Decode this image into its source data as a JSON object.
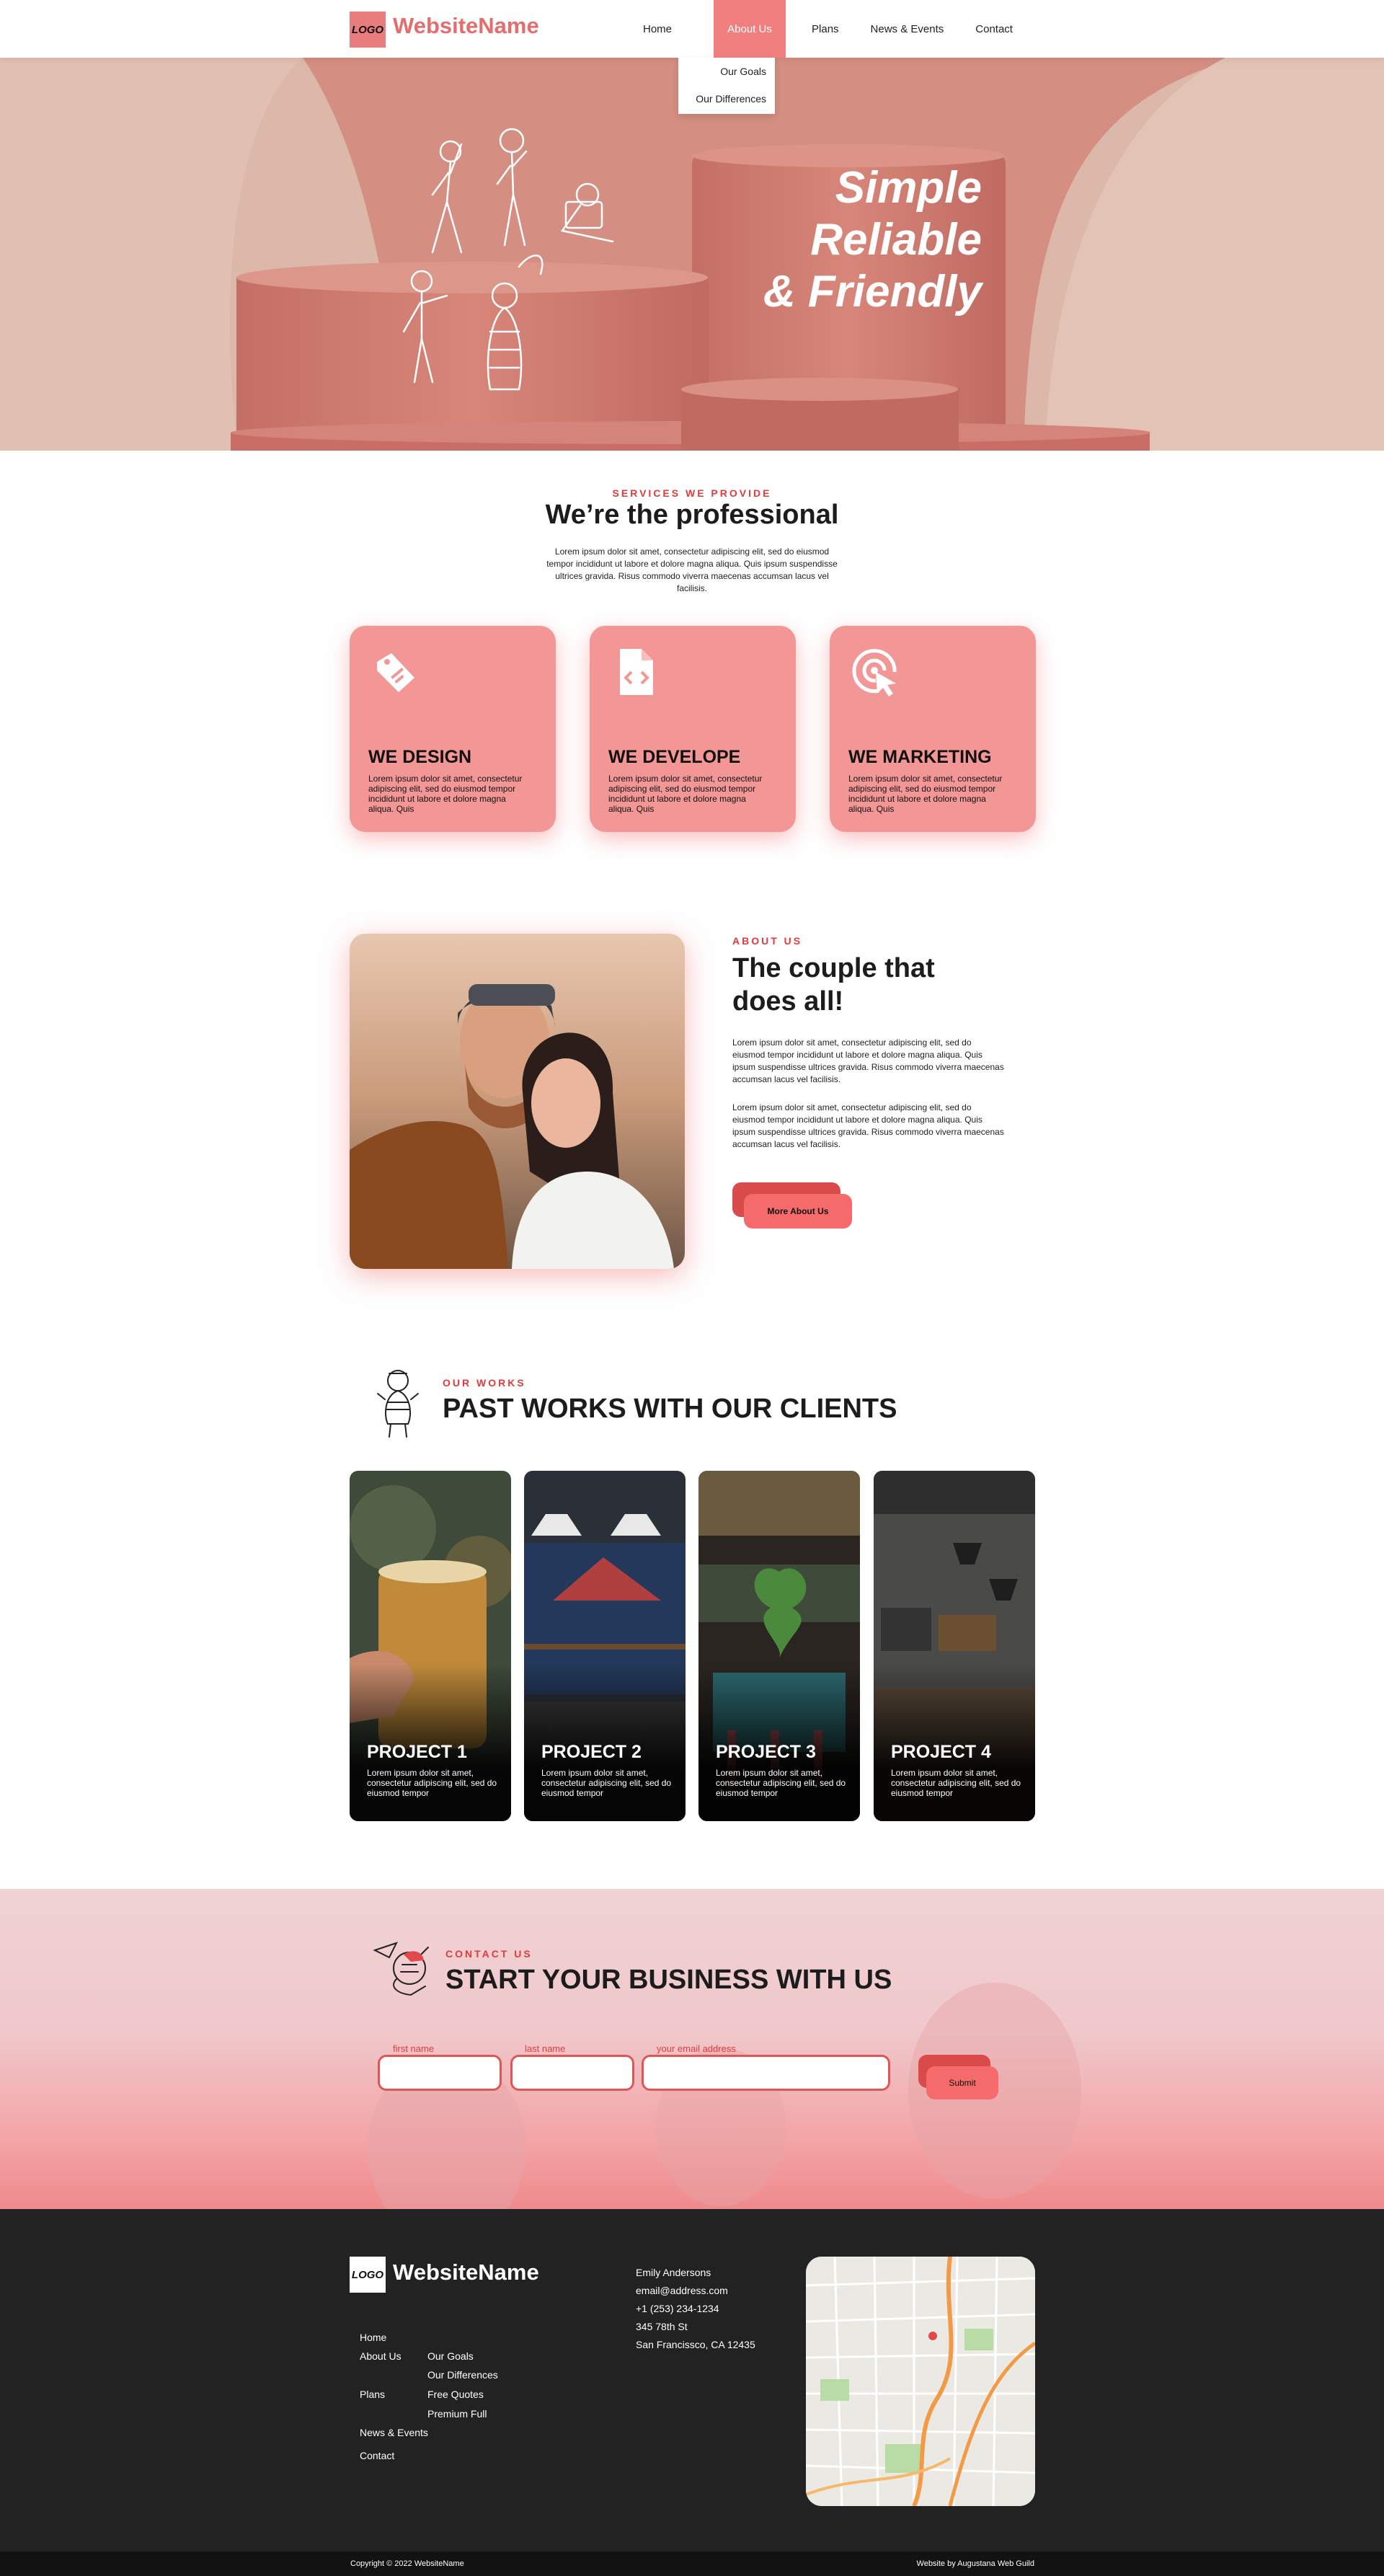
{
  "nav": {
    "logo": "LOGO",
    "site_name": "WebsiteName",
    "items": [
      "Home",
      "About Us",
      "Plans",
      "News & Events",
      "Contact"
    ],
    "active": "About Us",
    "dropdown": [
      "Our Goals",
      "Our Differences"
    ]
  },
  "hero": {
    "headline": [
      "Simple",
      "Reliable",
      "& Friendly"
    ]
  },
  "services": {
    "eyebrow": "SERVICES WE PROVIDE",
    "title": "We’re the professional",
    "text": "Lorem ipsum dolor sit amet, consectetur adipiscing elit, sed do eiusmod tempor incididunt ut labore et dolore magna aliqua. Quis ipsum suspendisse ultrices gravida. Risus commodo viverra maecenas accumsan lacus vel facilisis.",
    "cards": [
      {
        "title": "WE DESIGN",
        "icon": "tag-icon",
        "text": "Lorem ipsum dolor sit amet, consectetur adipiscing elit, sed do eiusmod tempor incididunt ut labore et dolore magna aliqua. Quis"
      },
      {
        "title": "WE DEVELOPE",
        "icon": "code-file-icon",
        "text": "Lorem ipsum dolor sit amet, consectetur adipiscing elit, sed do eiusmod tempor incididunt ut labore et dolore magna aliqua. Quis"
      },
      {
        "title": "WE MARKETING",
        "icon": "target-click-icon",
        "text": "Lorem ipsum dolor sit amet, consectetur adipiscing elit, sed do eiusmod tempor incididunt ut labore et dolore magna aliqua. Quis"
      }
    ]
  },
  "about": {
    "eyebrow": "ABOUT US",
    "title": "The couple that does all!",
    "paragraphs": [
      "Lorem ipsum dolor sit amet, consectetur adipiscing elit, sed do eiusmod tempor incididunt ut labore et dolore magna aliqua. Quis ipsum suspendisse ultrices gravida. Risus commodo viverra maecenas accumsan lacus vel facilisis.",
      "Lorem ipsum dolor sit amet, consectetur adipiscing elit, sed do eiusmod tempor incididunt ut labore et dolore magna aliqua. Quis ipsum suspendisse ultrices gravida. Risus commodo viverra maecenas accumsan lacus vel facilisis."
    ],
    "button": "More About Us"
  },
  "works": {
    "eyebrow": "OUR WORKS",
    "title": "PAST WORKS WITH OUR CLIENTS",
    "projects": [
      {
        "title": "PROJECT 1",
        "text": "Lorem ipsum dolor sit amet, consectetur adipiscing elit, sed do eiusmod tempor"
      },
      {
        "title": "PROJECT 2",
        "text": "Lorem ipsum dolor sit amet, consectetur adipiscing elit, sed do eiusmod tempor"
      },
      {
        "title": "PROJECT 3",
        "text": "Lorem ipsum dolor sit amet, consectetur adipiscing elit, sed do eiusmod tempor"
      },
      {
        "title": "PROJECT 4",
        "text": "Lorem ipsum dolor sit amet, consectetur adipiscing elit, sed do eiusmod tempor"
      }
    ]
  },
  "contact": {
    "eyebrow": "CONTACT US",
    "title": "START YOUR BUSINESS WITH US",
    "fields": [
      "first name",
      "last name",
      "your email address"
    ],
    "submit": "Submit"
  },
  "footer": {
    "logo": "LOGO",
    "site_name": "WebsiteName",
    "links": [
      "Home",
      "About Us",
      "Plans",
      "News & Events",
      "Contact"
    ],
    "about_sub": [
      "Our Goals",
      "Our Differences"
    ],
    "plans_sub": [
      "Free Quotes",
      "Premium Full"
    ],
    "contact": [
      "Emily Andersons",
      "email@address.com",
      "+1 (253) 234-1234",
      "345 78th St",
      "San Francissco, CA 12435"
    ],
    "copyright": "Copyright © 2022 WebsiteName",
    "credit": "Website by Augustana Web Guild"
  },
  "colors": {
    "accent": "#f27f7f",
    "accent_dark": "#e23b3b",
    "card": "#f39696",
    "footer": "#222222"
  }
}
